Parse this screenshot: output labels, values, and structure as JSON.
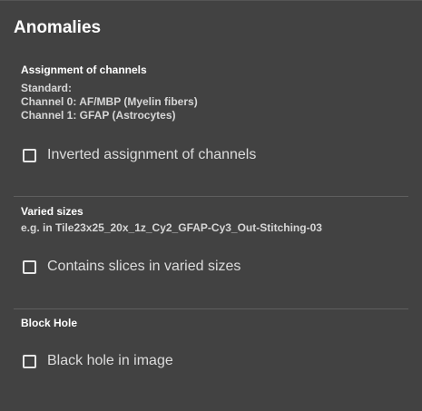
{
  "panel": {
    "title": "Anomalies"
  },
  "sections": {
    "channels": {
      "heading": "Assignment of channels",
      "lines": [
        "Standard:",
        "Channel 0: AF/MBP (Myelin fibers)",
        "Channel 1: GFAP (Astrocytes)"
      ],
      "checkbox_label": "Inverted assignment of channels",
      "checked": false
    },
    "sizes": {
      "heading": "Varied sizes",
      "lines": [
        "e.g. in Tile23x25_20x_1z_Cy2_GFAP-Cy3_Out-Stitching-03"
      ],
      "checkbox_label": "Contains slices in varied sizes",
      "checked": false
    },
    "hole": {
      "heading": "Block Hole",
      "checkbox_label": "Black hole in image",
      "checked": false
    }
  },
  "colors": {
    "background": "#424242",
    "heading": "#ffffff",
    "text": "#d6d6d6",
    "divider": "#5e5e5e"
  }
}
